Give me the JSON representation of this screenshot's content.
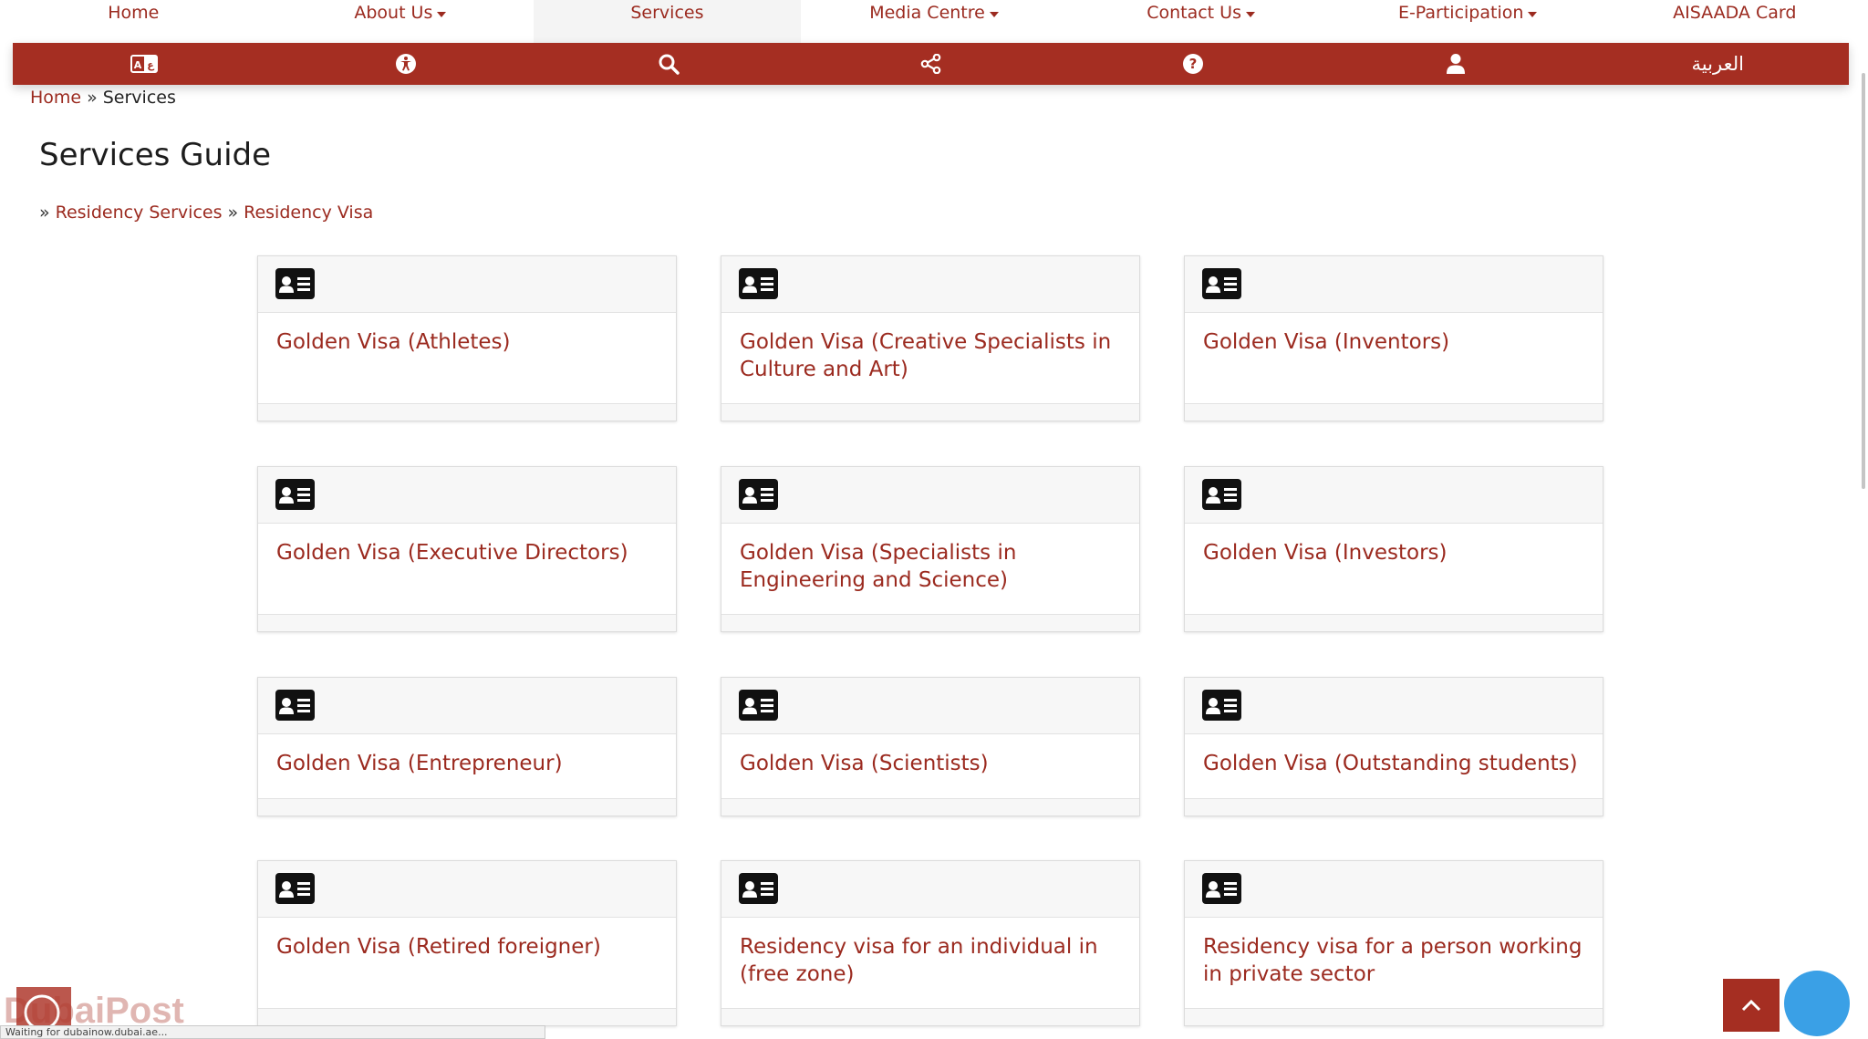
{
  "nav": {
    "items": [
      {
        "label": "Home",
        "dropdown": false,
        "active": false
      },
      {
        "label": "About Us",
        "dropdown": true,
        "active": false
      },
      {
        "label": "Services",
        "dropdown": false,
        "active": true
      },
      {
        "label": "Media Centre",
        "dropdown": true,
        "active": false
      },
      {
        "label": "Contact Us",
        "dropdown": true,
        "active": false
      },
      {
        "label": "E-Participation",
        "dropdown": true,
        "active": false
      },
      {
        "label": "AISAADA Card",
        "dropdown": false,
        "active": false
      }
    ]
  },
  "toolbar": {
    "icons": [
      "translate-icon",
      "accessibility-icon",
      "search-icon",
      "share-icon",
      "help-icon",
      "user-icon"
    ],
    "language_label": "العربية",
    "background_color": "#a52e22"
  },
  "breadcrumb": {
    "home": "Home",
    "separator": "»",
    "current": "Services"
  },
  "page": {
    "title": "Services Guide",
    "subcrumb_sep": "»",
    "subcrumb": [
      "Residency Services",
      "Residency Visa"
    ]
  },
  "cards": [
    {
      "title": "Golden Visa (Athletes)",
      "icon": "id-card-icon"
    },
    {
      "title": "Golden Visa (Creative Specialists in Culture and Art)",
      "icon": "id-card-icon"
    },
    {
      "title": "Golden Visa (Inventors)",
      "icon": "id-card-icon"
    },
    {
      "title": "Golden Visa (Executive Directors)",
      "icon": "id-card-icon"
    },
    {
      "title": "Golden Visa (Specialists in Engineering and Science)",
      "icon": "id-card-icon"
    },
    {
      "title": "Golden Visa (Investors)",
      "icon": "id-card-icon"
    },
    {
      "title": "Golden Visa (Entrepreneur)",
      "icon": "id-card-icon"
    },
    {
      "title": "Golden Visa (Scientists)",
      "icon": "id-card-icon"
    },
    {
      "title": "Golden Visa (Outstanding students)",
      "icon": "id-card-icon"
    },
    {
      "title": "Golden Visa (Retired foreigner)",
      "icon": "id-card-icon"
    },
    {
      "title": "Residency visa for an individual in (free zone)",
      "icon": "id-card-icon"
    },
    {
      "title": "Residency visa for a person working in private sector",
      "icon": "id-card-icon"
    }
  ],
  "status_bar": {
    "text": "Waiting for dubainow.dubai.ae..."
  },
  "watermark": {
    "text": "DubaiPost"
  },
  "colors": {
    "accent": "#9b2a1f",
    "chat": "#3aa0e6"
  }
}
